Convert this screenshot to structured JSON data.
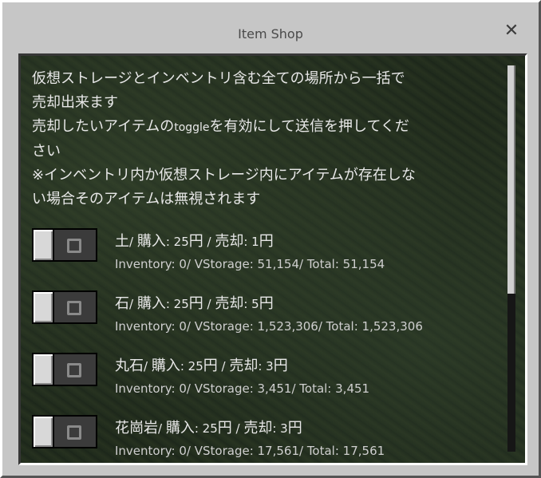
{
  "window": {
    "title": "Item Shop"
  },
  "description": [
    {
      "parts": [
        {
          "t": "仮想ストレージとインベントリ含む全ての場所から一括で"
        }
      ]
    },
    {
      "parts": [
        {
          "t": "売却出来ます"
        }
      ]
    },
    {
      "parts": [
        {
          "t": "売却したいアイテムの"
        },
        {
          "t": "toggle",
          "small": true
        },
        {
          "t": "を有効にして送信を押してくだ"
        }
      ]
    },
    {
      "parts": [
        {
          "t": "さい"
        }
      ]
    },
    {
      "parts": [
        {
          "t": "※インベントリ内か仮想ストレージ内にアイテムが存在しな"
        }
      ]
    },
    {
      "parts": [
        {
          "t": "い場合そのアイテムは無視されます"
        }
      ]
    }
  ],
  "items": [
    {
      "name": "土",
      "buy_label": "購入",
      "buy": "25円",
      "sell_label": "売却",
      "sell": "1円",
      "stock": "Inventory: 0/ VStorage: 51,154/ Total: 51,154",
      "enabled": false
    },
    {
      "name": "石",
      "buy_label": "購入",
      "buy": "25円",
      "sell_label": "売却",
      "sell": "5円",
      "stock": "Inventory: 0/ VStorage: 1,523,306/ Total: 1,523,306",
      "enabled": false
    },
    {
      "name": "丸石",
      "buy_label": "購入",
      "buy": "25円",
      "sell_label": "売却",
      "sell": "3円",
      "stock": "Inventory: 0/ VStorage: 3,451/ Total: 3,451",
      "enabled": false
    },
    {
      "name": "花崗岩",
      "buy_label": "購入",
      "buy": "25円",
      "sell_label": "売却",
      "sell": "3円",
      "stock": "Inventory: 0/ VStorage: 17,561/ Total: 17,561",
      "enabled": false
    }
  ],
  "icons": {
    "close": "close-icon"
  },
  "scroll": {
    "position": 0.0,
    "visible_fraction": 0.59
  }
}
